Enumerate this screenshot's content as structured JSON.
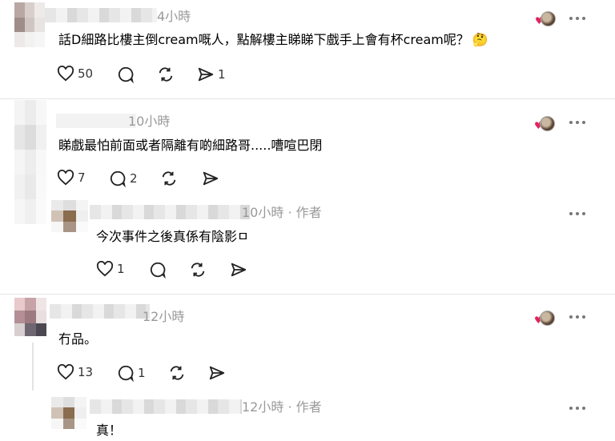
{
  "comments": [
    {
      "time": "4小時",
      "text": "話D細路比樓主倒cream嘅人，點解樓主睇睇下戲手上會有杯cream呢？",
      "emoji": "🤔",
      "likes": "50",
      "replies": "",
      "reposts": "",
      "shares": "1"
    },
    {
      "time": "10小時",
      "text": "睇戲最怕前面或者隔離有啲細路哥.....嘈喧巴閉",
      "likes": "7",
      "replies": "2"
    },
    {
      "time": "10小時 · 作者",
      "text": "今次事件之後真係有陰影ㅁ",
      "likes": "1"
    },
    {
      "time": "12小時",
      "text": "冇品。",
      "likes": "13",
      "replies": "1"
    },
    {
      "time": "12小時 · 作者",
      "text": "真！"
    }
  ],
  "icons": {
    "like": "heart-outline-icon",
    "reply": "speech-bubble-icon",
    "repost": "repost-arrows-icon",
    "share": "paper-plane-icon",
    "more": "more-dots-icon"
  }
}
